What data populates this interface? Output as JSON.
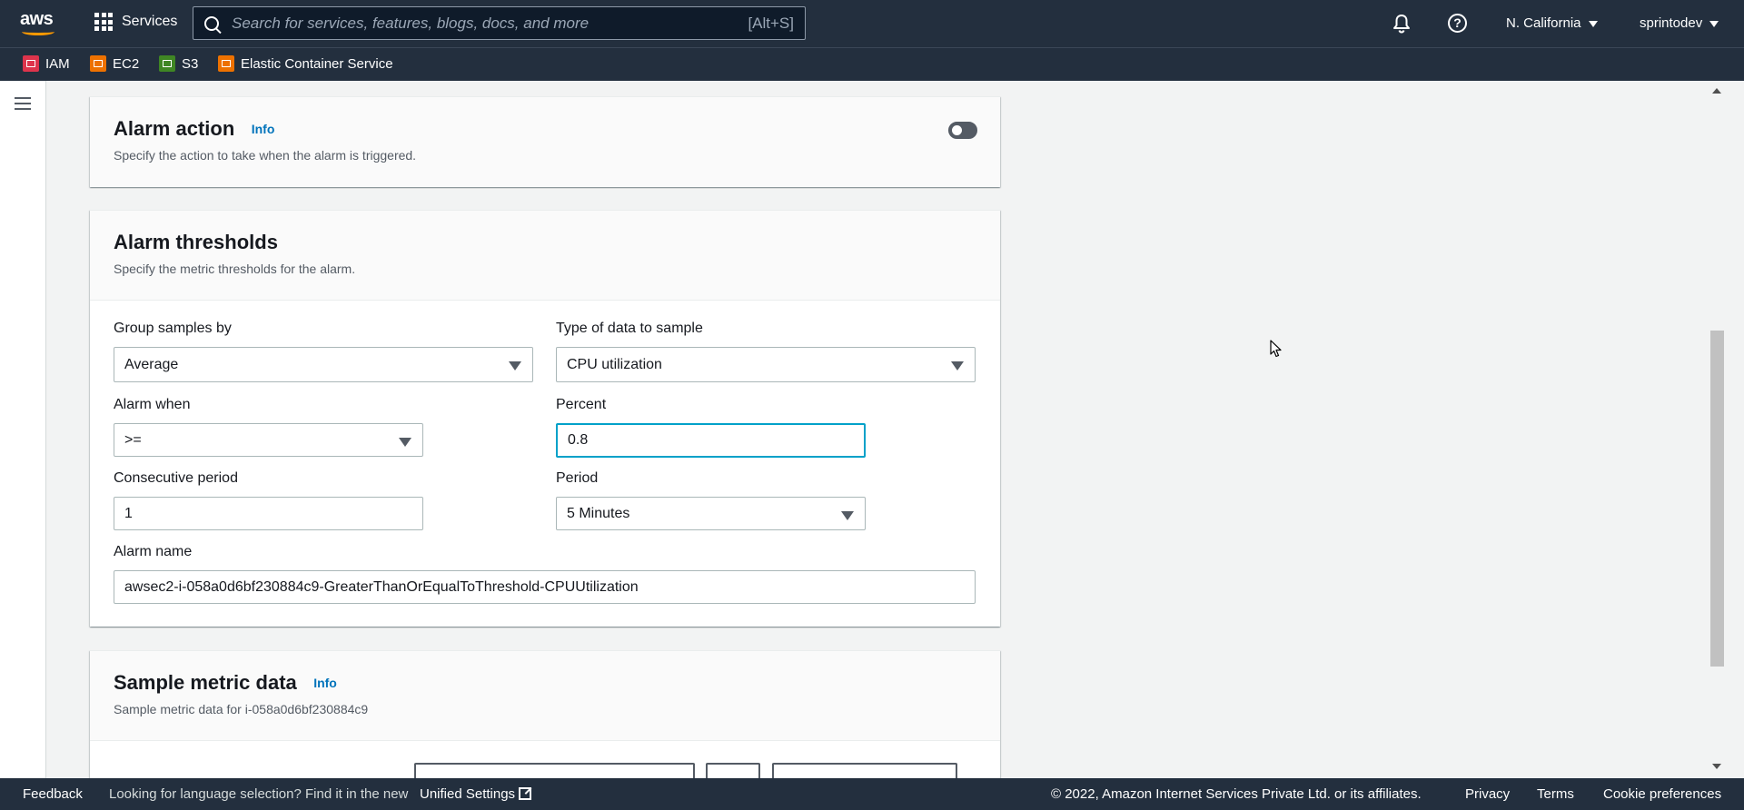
{
  "topnav": {
    "logo_text": "aws",
    "services_label": "Services",
    "search_placeholder": "Search for services, features, blogs, docs, and more",
    "search_shortcut": "[Alt+S]",
    "region": "N. California",
    "account": "sprintodev"
  },
  "favorites": [
    {
      "label": "IAM",
      "color": "#dd344c",
      "icon": "iam-icon"
    },
    {
      "label": "EC2",
      "color": "#ed7100",
      "icon": "ec2-icon"
    },
    {
      "label": "S3",
      "color": "#3f8624",
      "icon": "s3-icon"
    },
    {
      "label": "Elastic Container Service",
      "color": "#ed7100",
      "icon": "ecs-icon"
    }
  ],
  "alarm_action": {
    "title": "Alarm action",
    "info": "Info",
    "description": "Specify the action to take when the alarm is triggered.",
    "enabled": false
  },
  "thresholds": {
    "title": "Alarm thresholds",
    "description": "Specify the metric thresholds for the alarm.",
    "group_samples_label": "Group samples by",
    "group_samples_value": "Average",
    "data_type_label": "Type of data to sample",
    "data_type_value": "CPU utilization",
    "alarm_when_label": "Alarm when",
    "alarm_when_value": ">=",
    "percent_label": "Percent",
    "percent_value": "0.8",
    "consecutive_label": "Consecutive period",
    "consecutive_value": "1",
    "period_label": "Period",
    "period_value": "5 Minutes",
    "alarm_name_label": "Alarm name",
    "alarm_name_value": "awsec2-i-058a0d6bf230884c9-GreaterThanOrEqualToThreshold-CPUUtilization"
  },
  "sample_metric": {
    "title": "Sample metric data",
    "info": "Info",
    "description": "Sample metric data for i-058a0d6bf230884c9"
  },
  "footer": {
    "feedback": "Feedback",
    "language_prompt": "Looking for language selection? Find it in the new",
    "unified_settings": "Unified Settings",
    "copyright": "© 2022, Amazon Internet Services Private Ltd. or its affiliates.",
    "privacy": "Privacy",
    "terms": "Terms",
    "cookie_preferences": "Cookie preferences"
  },
  "colors": {
    "nav_bg": "#232f3e",
    "link": "#0073bb",
    "focus": "#00a1c9"
  }
}
